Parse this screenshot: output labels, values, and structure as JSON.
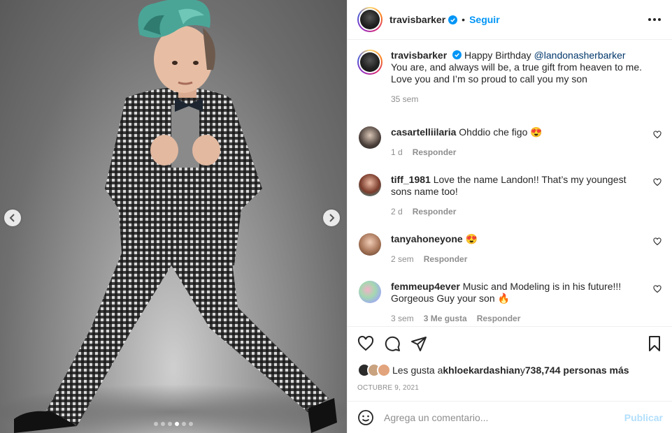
{
  "post": {
    "username": "travisbarker",
    "follow_label": "Seguir",
    "separator": "•",
    "accent": "#0095f6"
  },
  "caption": {
    "username": "travisbarker",
    "greeting": "Happy Birthday ",
    "mention": "@landonasherbarker",
    "text": "You are, and always will be, a true gift from heaven to me. Love you and I’m so proud to call you my son",
    "time": "35 sem"
  },
  "comments": [
    {
      "username": "casartelliilaria",
      "text": "Ohddio che figo 😍",
      "time": "1 d",
      "reply": "Responder",
      "likes": ""
    },
    {
      "username": "tiff_1981",
      "text": "Love the name Landon!! That’s my youngest sons name too!",
      "time": "2 d",
      "reply": "Responder",
      "likes": ""
    },
    {
      "username": "tanyahoneyone",
      "text": "😍",
      "time": "2 sem",
      "reply": "Responder",
      "likes": ""
    },
    {
      "username": "femmeup4ever",
      "text": "Music and Modeling is in his future!!! Gorgeous Guy your son 🔥",
      "time": "3 sem",
      "reply": "Responder",
      "likes": "3 Me gusta"
    }
  ],
  "likes": {
    "prefix": "Les gusta a ",
    "first_user": "khloekardashian",
    "middle": " y ",
    "count": "738,744 personas más"
  },
  "date": "OCTUBRE 9, 2021",
  "composer": {
    "placeholder": "Agrega un comentario...",
    "publish_label": "Publicar"
  },
  "carousel": {
    "slides": 6,
    "active_index": 3
  },
  "icons": [
    "verified-badge-icon",
    "more-options-icon",
    "like-icon",
    "comment-icon",
    "share-icon",
    "save-icon",
    "emoji-icon",
    "heart-icon",
    "chevron-left-icon",
    "chevron-right-icon"
  ]
}
